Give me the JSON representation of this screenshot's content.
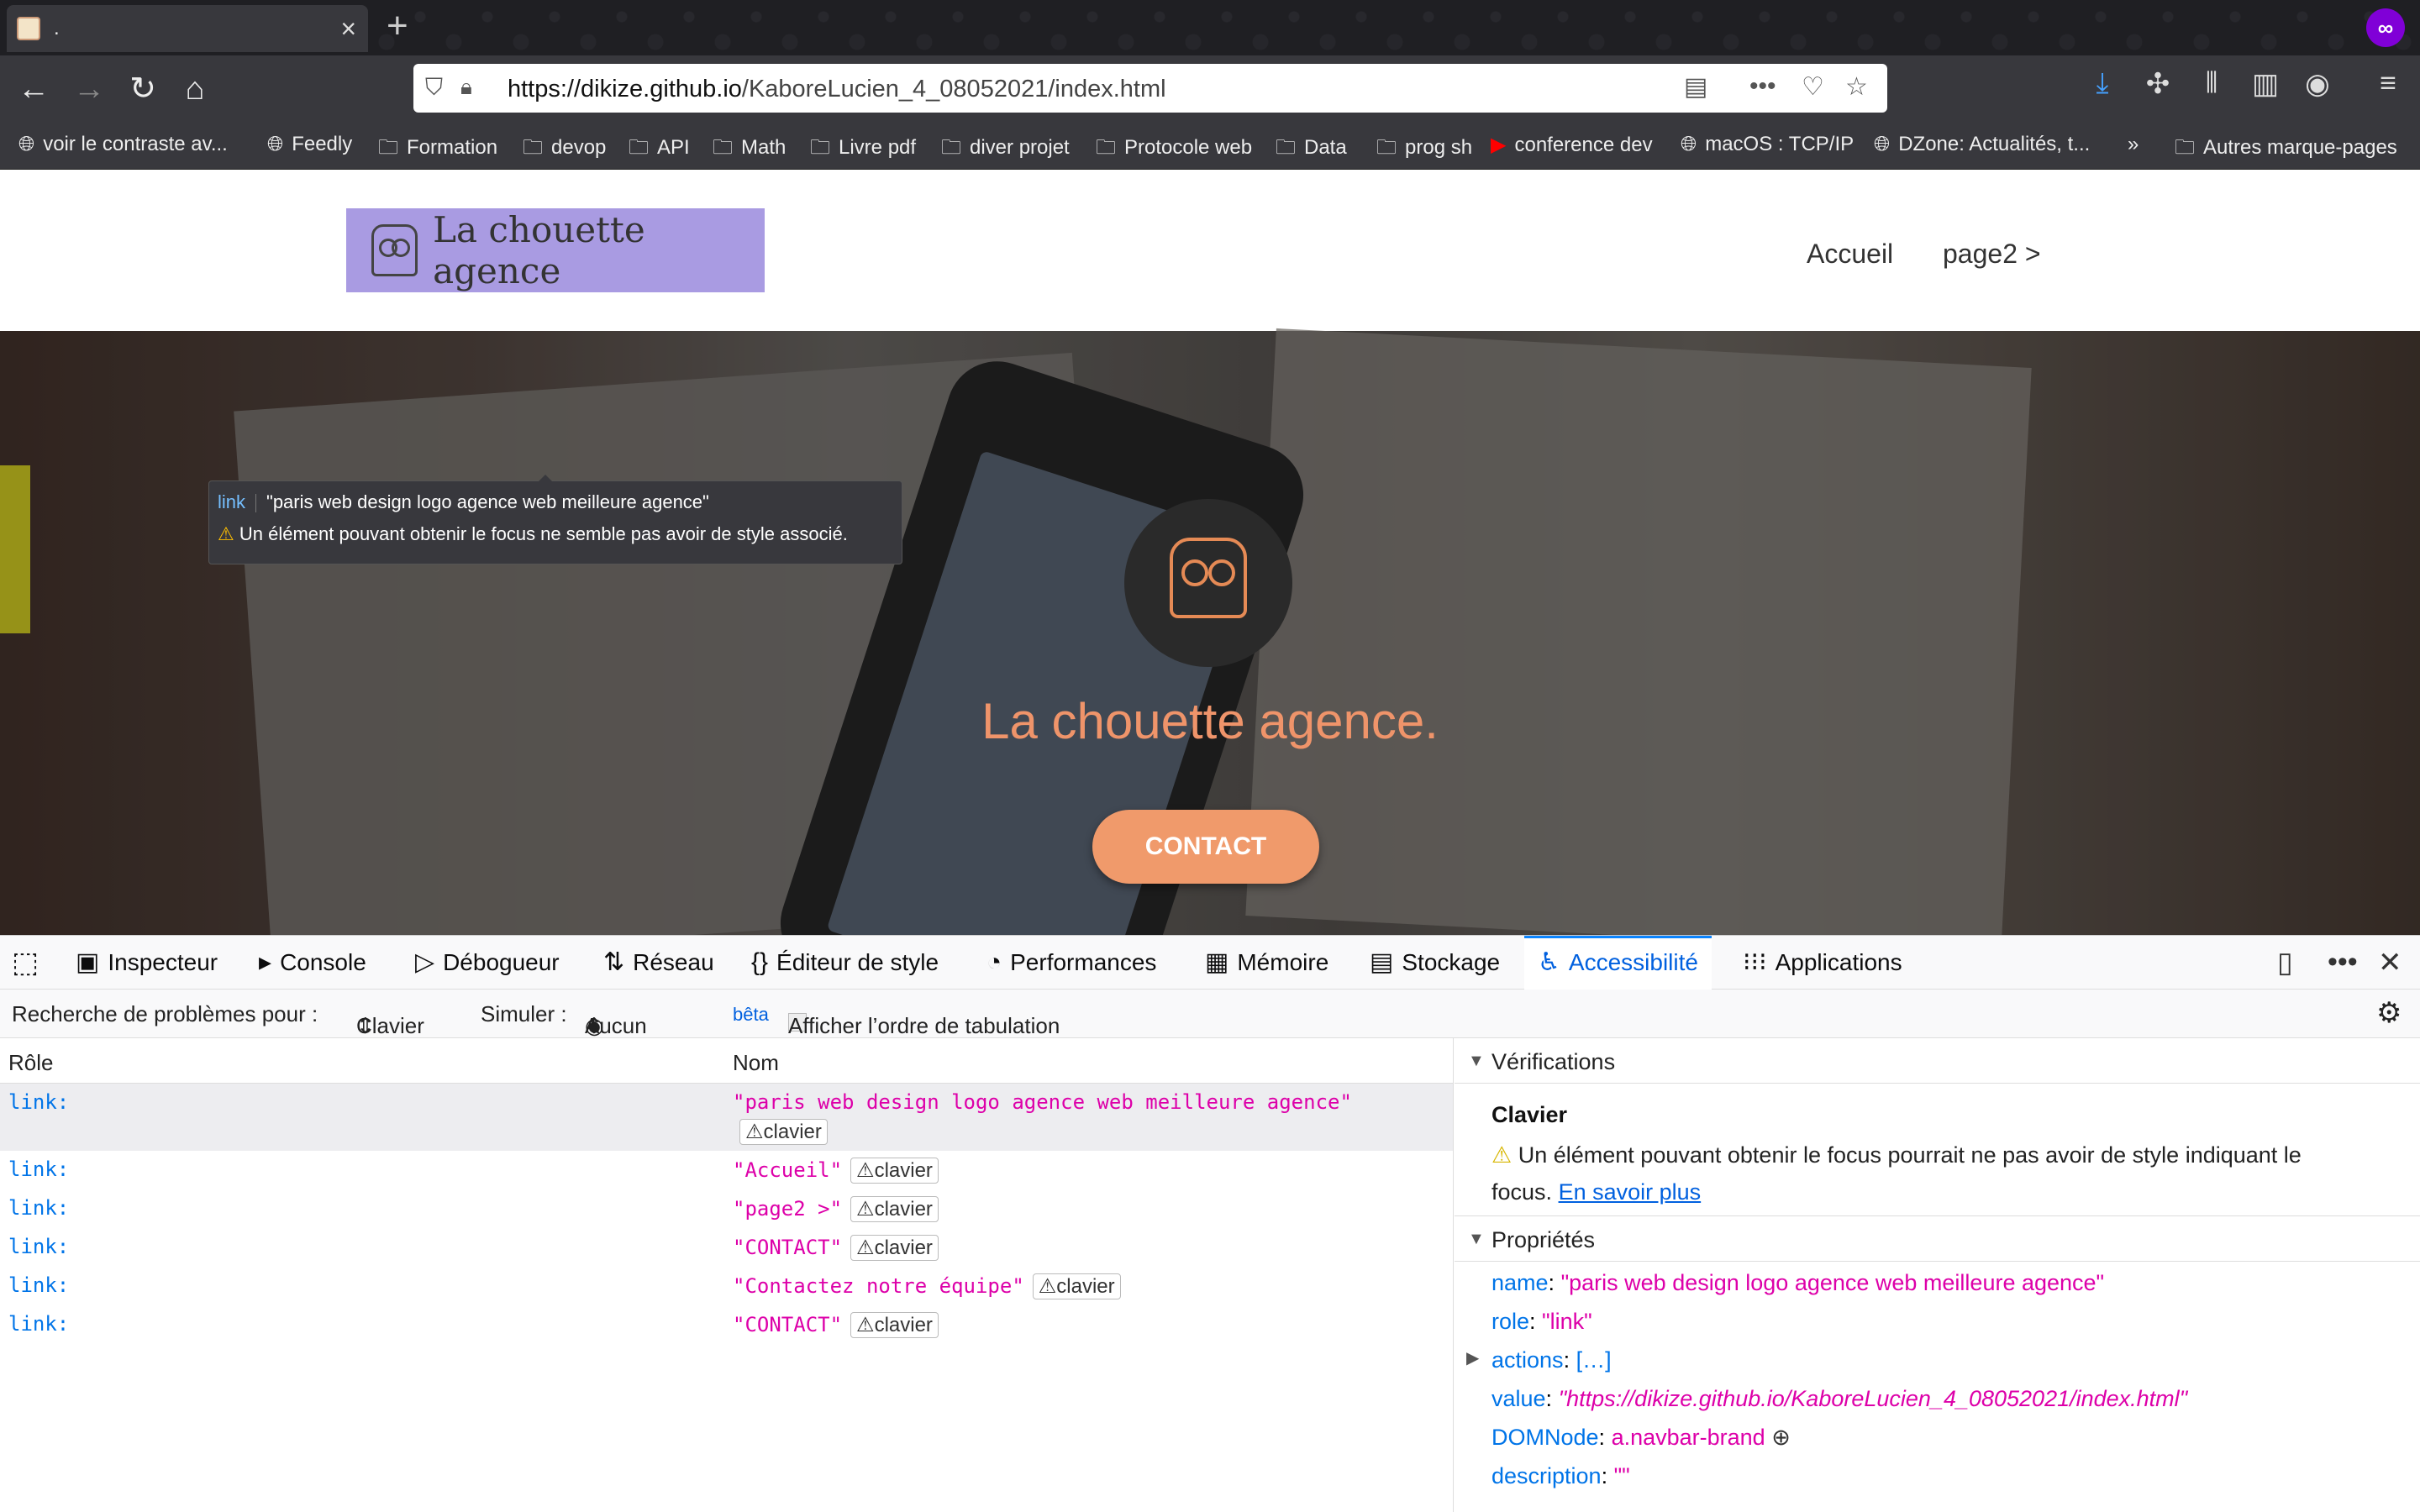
{
  "browser": {
    "tab_title": ".",
    "url_host": "https://dikize.github.io",
    "url_path": "/KaboreLucien_4_08052021/index.html",
    "bookmarks": [
      {
        "label": "voir le contraste av...",
        "icon": "globe-icon"
      },
      {
        "label": "Feedly",
        "icon": "globe-icon"
      },
      {
        "label": "Formation",
        "icon": "folder-icon"
      },
      {
        "label": "devop",
        "icon": "folder-icon"
      },
      {
        "label": "API",
        "icon": "folder-icon"
      },
      {
        "label": "Math",
        "icon": "folder-icon"
      },
      {
        "label": "Livre pdf",
        "icon": "folder-icon"
      },
      {
        "label": "diver projet",
        "icon": "folder-icon"
      },
      {
        "label": "Protocole web",
        "icon": "folder-icon"
      },
      {
        "label": "Data",
        "icon": "folder-icon"
      },
      {
        "label": "prog sh",
        "icon": "folder-icon"
      },
      {
        "label": "conference dev",
        "icon": "youtube-icon"
      },
      {
        "label": "macOS : TCP/IP",
        "icon": "globe-icon"
      },
      {
        "label": "DZone: Actualités, t...",
        "icon": "globe-icon"
      },
      {
        "label": "Autres marque-pages",
        "icon": "folder-icon"
      }
    ]
  },
  "site": {
    "brand": "La chouette agence",
    "nav": [
      "Accueil",
      "page2 >"
    ],
    "hero_title": "La chouette agence.",
    "cta": "CONTACT",
    "accent_color": "#ef946a",
    "brand_bg": "#a99be2"
  },
  "tooltip": {
    "role": "link",
    "name": "\"paris web design logo agence web meilleure agence\"",
    "warning": "Un élément pouvant obtenir le focus ne semble pas avoir de style associé."
  },
  "devtools": {
    "tabs": [
      "Inspecteur",
      "Console",
      "Débogueur",
      "Réseau",
      "Éditeur de style",
      "Performances",
      "Mémoire",
      "Stockage",
      "Accessibilité",
      "Applications"
    ],
    "active_tab": "Accessibilité",
    "toolbar": {
      "check_label": "Recherche de problèmes pour :",
      "check_value": "Clavier",
      "simulate_label": "Simuler :",
      "simulate_value": "Aucun",
      "beta": "bêta",
      "tab_order": "Afficher l’ordre de tabulation"
    },
    "columns": {
      "role": "Rôle",
      "name": "Nom"
    },
    "rows": [
      {
        "role": "link:",
        "name": "\"paris web design logo agence web meilleure agence\"",
        "badge": "clavier"
      },
      {
        "role": "link:",
        "name": "\"Accueil\"",
        "badge": "clavier"
      },
      {
        "role": "link:",
        "name": "\"page2 >\"",
        "badge": "clavier"
      },
      {
        "role": "link:",
        "name": "\"CONTACT\"",
        "badge": "clavier"
      },
      {
        "role": "link:",
        "name": "\"Contactez notre équipe\"",
        "badge": "clavier"
      },
      {
        "role": "link:",
        "name": "\"CONTACT\"",
        "badge": "clavier"
      }
    ],
    "checks": {
      "title": "Vérifications",
      "category": "Clavier",
      "message": "Un élément pouvant obtenir le focus pourrait ne pas avoir de style indiquant le",
      "message2": "focus.",
      "learn_more": "En savoir plus"
    },
    "properties": {
      "title": "Propriétés",
      "name_key": "name",
      "name_val": "\"paris web design logo agence web meilleure agence\"",
      "role_key": "role",
      "role_val": "\"link\"",
      "actions_key": "actions",
      "actions_val": "[…]",
      "value_key": "value",
      "value_val": "\"https://dikize.github.io/KaboreLucien_4_08052021/index.html\"",
      "domnode_key": "DOMNode",
      "domnode_val": "a.navbar-brand",
      "description_key": "description",
      "description_val": "\"\""
    }
  }
}
